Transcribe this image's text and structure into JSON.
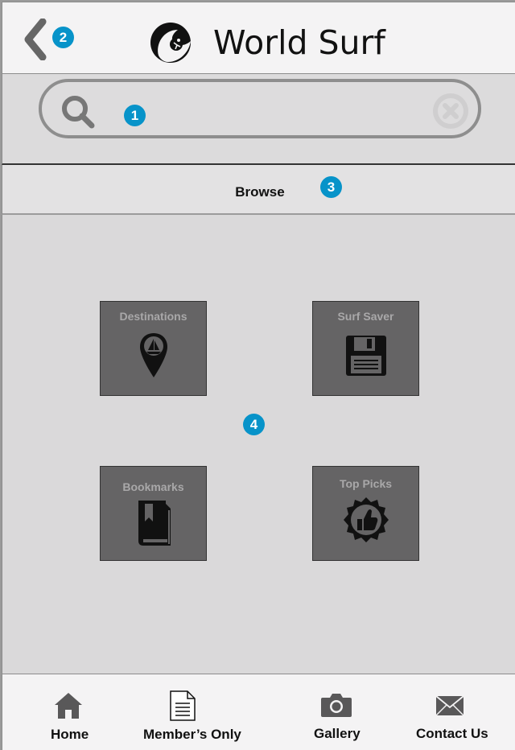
{
  "header": {
    "title": "World Surf",
    "back_icon": "chevron-left-icon",
    "logo_icon": "surfer-wave-logo"
  },
  "search": {
    "placeholder": "",
    "search_icon": "search-icon",
    "clear_icon": "clear-icon"
  },
  "browse": {
    "label": "Browse"
  },
  "tiles": [
    {
      "label": "Destinations",
      "icon": "map-pin-sailboat-icon"
    },
    {
      "label": "Surf Saver",
      "icon": "floppy-disk-icon"
    },
    {
      "label": "Bookmarks",
      "icon": "bookmark-book-icon"
    },
    {
      "label": "Top Picks",
      "icon": "thumbs-up-badge-icon"
    }
  ],
  "nav": [
    {
      "label": "Home",
      "icon": "home-icon"
    },
    {
      "label": "Member’s Only",
      "icon": "document-icon"
    },
    {
      "label": "Gallery",
      "icon": "camera-icon"
    },
    {
      "label": "Contact Us",
      "icon": "envelope-icon"
    }
  ],
  "annotations": [
    "1",
    "2",
    "3",
    "4"
  ],
  "colors": {
    "marker": "#0793c9",
    "tile": "#656465",
    "background": "#dad9da"
  }
}
